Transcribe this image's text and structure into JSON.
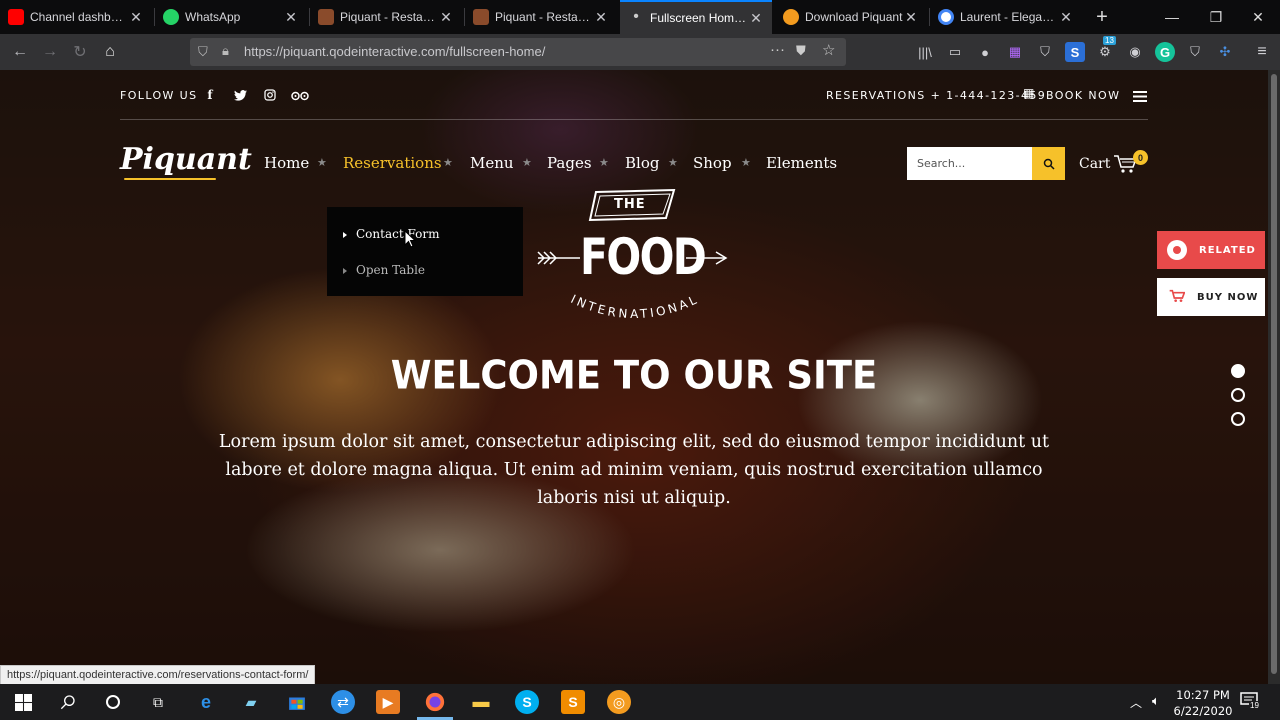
{
  "browser": {
    "tabs": [
      {
        "title": "Channel dashboard – YouTube",
        "icon": "youtube-icon",
        "color": "#ff0000"
      },
      {
        "title": "WhatsApp",
        "icon": "whatsapp-icon",
        "color": "#25d366"
      },
      {
        "title": "Piquant - Restaurant",
        "icon": "piquant-favicon",
        "color": "#8a4b2b"
      },
      {
        "title": "Piquant - Restaurant",
        "icon": "piquant-favicon",
        "color": "#8a4b2b"
      },
      {
        "title": "Fullscreen Home – P",
        "icon": "loading-dot-icon",
        "color": "#cccccc"
      },
      {
        "title": "Download Piquant",
        "icon": "envato-icon",
        "color": "#f39b1f"
      },
      {
        "title": "Laurent - Elegant Re",
        "icon": "google-icon",
        "color": "#4285f4"
      }
    ],
    "url_prefix": "https://",
    "url": "https://piquant.qodeinteractive.com/fullscreen-home/",
    "extension_badge": "13",
    "status_link": "https://piquant.qodeinteractive.com/reservations-contact-form/"
  },
  "site": {
    "follow_us": "FOLLOW US",
    "social": [
      "f",
      "t",
      "ig",
      "ta"
    ],
    "reservations": "RESERVATIONS + 1-444-123-459",
    "book_now": "BOOK NOW",
    "logo": "Piquant",
    "menu": [
      {
        "label": "Home",
        "active": false
      },
      {
        "label": "Reservations",
        "active": true
      },
      {
        "label": "Menu",
        "active": false
      },
      {
        "label": "Pages",
        "active": false
      },
      {
        "label": "Blog",
        "active": false
      },
      {
        "label": "Shop",
        "active": false
      },
      {
        "label": "Elements",
        "active": false
      }
    ],
    "search_placeholder": "Search...",
    "cart_label": "Cart",
    "cart_count": "0",
    "dropdown": [
      "Contact Form",
      "Open Table"
    ],
    "badge": {
      "the": "THE",
      "food": "FOOD",
      "international": "INTERNATIONAL"
    },
    "hero_title": "WELCOME TO OUR SITE",
    "hero_text": "Lorem ipsum dolor sit amet, consectetur adipiscing elit, sed do eiusmod tempor incididunt ut labore et dolore magna aliqua. Ut enim ad minim veniam, quis nostrud exercitation ullamco laboris nisi ut aliquip.",
    "related": "RELATED",
    "buy_now": "BUY NOW",
    "accent": "#f6c12a",
    "related_color": "#e84a4a"
  },
  "taskbar": {
    "time": "10:27 PM",
    "date": "6/22/2020",
    "notifications": "19"
  }
}
